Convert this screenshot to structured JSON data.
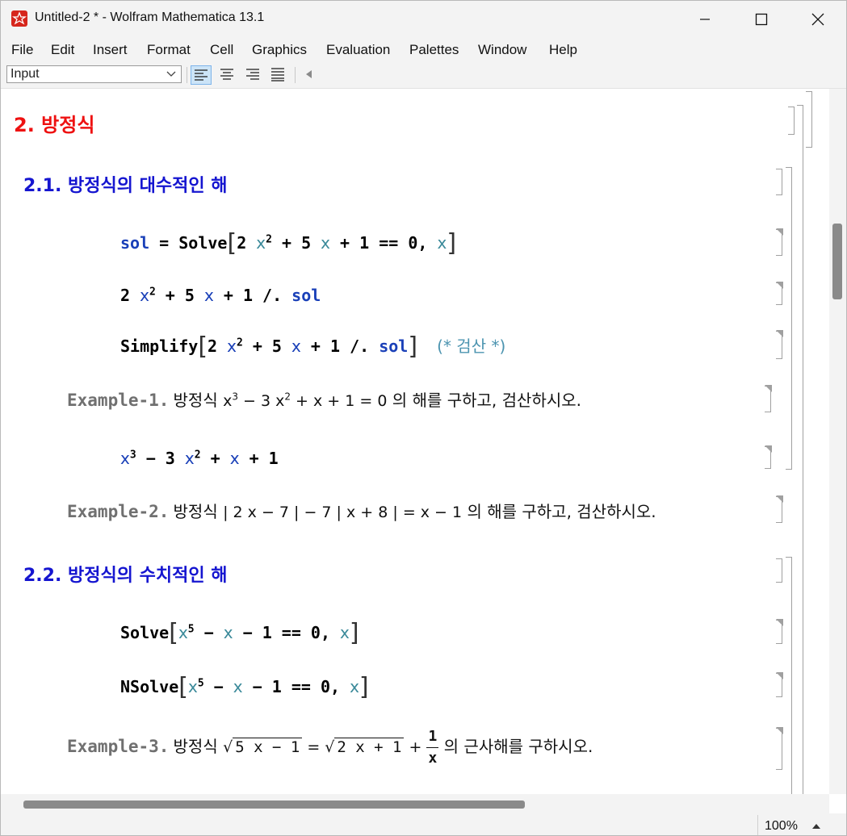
{
  "window": {
    "title": "Untitled-2 * - Wolfram Mathematica 13.1"
  },
  "menu": [
    "File",
    "Edit",
    "Insert",
    "Format",
    "Cell",
    "Graphics",
    "Evaluation",
    "Palettes",
    "Window",
    "Help"
  ],
  "toolbar": {
    "style_value": "Input"
  },
  "notebook": {
    "section_title": "2. 방정식",
    "subsection1_title": "2.1. 방정식의 대수적인 해",
    "input1": {
      "sol": "sol",
      "eq": " = ",
      "fn": "Solve",
      "a": "2 ",
      "x1": "x",
      "p1": "2",
      "b": " + 5 ",
      "x2": "x",
      "c": " + 1 == 0, ",
      "x3": "x"
    },
    "input2": {
      "a": "2 ",
      "x1": "x",
      "p1": "2",
      "b": " + 5 ",
      "x2": "x",
      "c": " + 1 /. ",
      "sol": "sol"
    },
    "input3": {
      "fn": "Simplify",
      "a": "2 ",
      "x1": "x",
      "p1": "2",
      "b": " + 5 ",
      "x2": "x",
      "c": " + 1 /. ",
      "sol": "sol",
      "comment": "(* 검산 *)"
    },
    "example1": {
      "label": "Example-1.",
      "pre": "방정식 ",
      "x1": "x",
      "p1": "3",
      "m1": " − 3 ",
      "x2": "x",
      "p2": "2",
      "m2": " + ",
      "x3": "x",
      "m3": " + 1 = 0",
      "post": " 의 해를 구하고,  검산하시오."
    },
    "input4": {
      "x1": "x",
      "p1": "3",
      "a": " − 3 ",
      "x2": "x",
      "p2": "2",
      "b": " + ",
      "x3": "x",
      "c": " + 1"
    },
    "example2": {
      "label": "Example-2.",
      "pre": "방정식 ",
      "math": "| 2 x − 7 | − 7 | x + 8 | = x − 1",
      "post": " 의 해를 구하고,  검산하시오."
    },
    "subsection2_title": "2.2. 방정식의 수치적인 해",
    "input5": {
      "fn": "Solve",
      "x1": "x",
      "p1": "5",
      "a": " − ",
      "x2": "x",
      "b": " − 1 == 0, ",
      "x3": "x"
    },
    "input6": {
      "fn": "NSolve",
      "x1": "x",
      "p1": "5",
      "a": " − ",
      "x2": "x",
      "b": " − 1 == 0, ",
      "x3": "x"
    },
    "example3": {
      "label": "Example-3.",
      "pre": "방정식 ",
      "rad1": "5 x − 1",
      "eq": " = ",
      "rad2": "2 x + 1",
      "plus": " + ",
      "num": "1",
      "den": "x",
      "post": " 의 근사해를 구하시오."
    }
  },
  "status": {
    "zoom": "100%"
  },
  "colors": {
    "section": "#ee1111",
    "subsection": "#1515d0",
    "symbol": "#1a40b8",
    "variable": "#3b8a9a",
    "example_label": "#707070"
  }
}
